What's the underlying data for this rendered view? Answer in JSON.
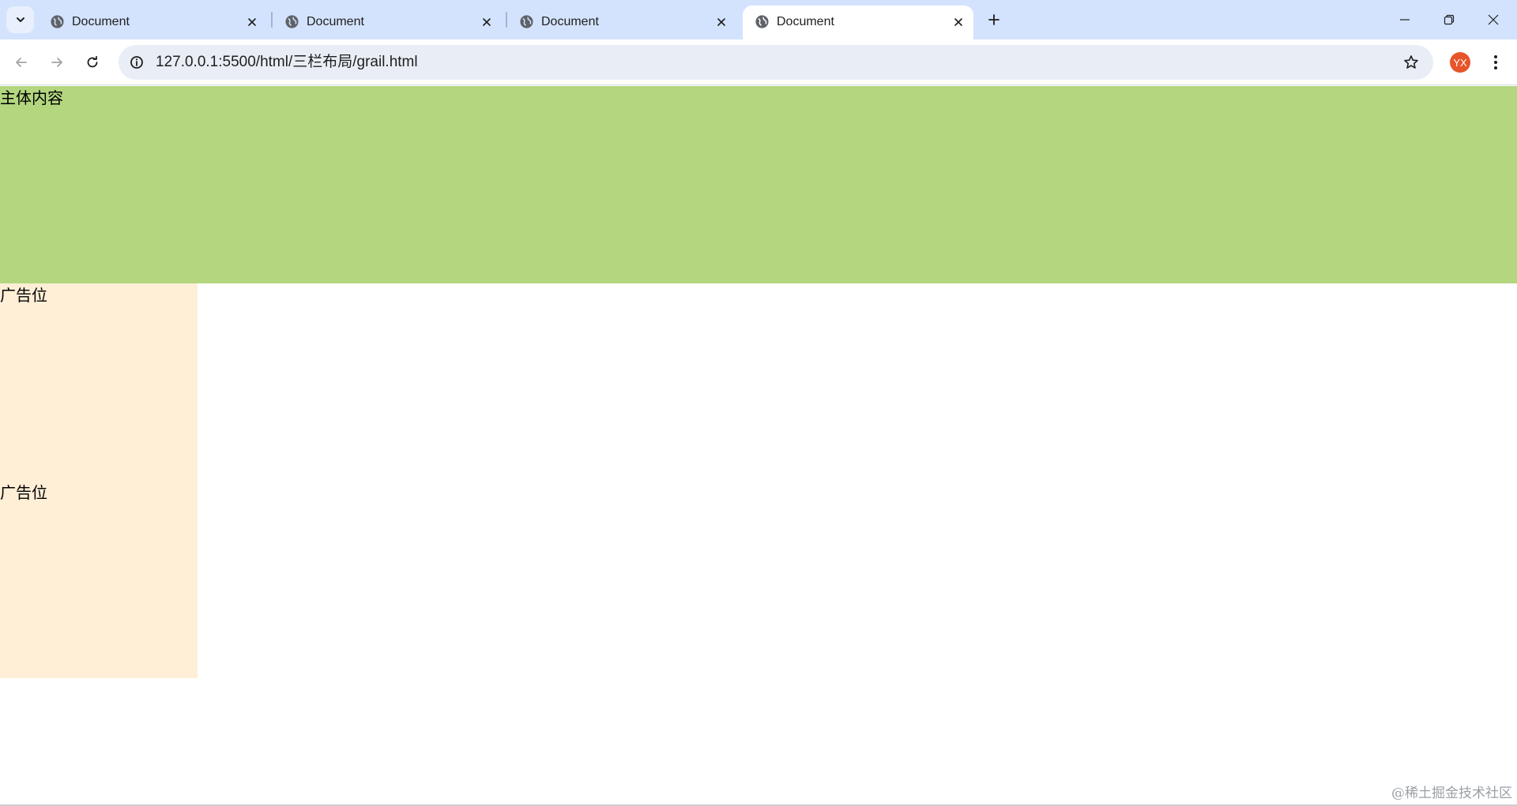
{
  "browser": {
    "tabs": [
      {
        "title": "Document",
        "active": false
      },
      {
        "title": "Document",
        "active": false
      },
      {
        "title": "Document",
        "active": false
      },
      {
        "title": "Document",
        "active": true
      }
    ],
    "address_bar": {
      "url": "127.0.0.1:5500/html/三栏布局/grail.html"
    },
    "profile": {
      "initials": "YX",
      "color": "#e8542a"
    },
    "colors": {
      "tabstrip": "#d3e3fd",
      "omnibox": "#e9eef6"
    }
  },
  "page": {
    "main": {
      "text": "主体内容",
      "color": "#b3d67f"
    },
    "ads": [
      {
        "text": "广告位",
        "color": "#feefd6"
      },
      {
        "text": "广告位",
        "color": "#feefd6"
      }
    ],
    "watermark": "@稀土掘金技术社区"
  }
}
